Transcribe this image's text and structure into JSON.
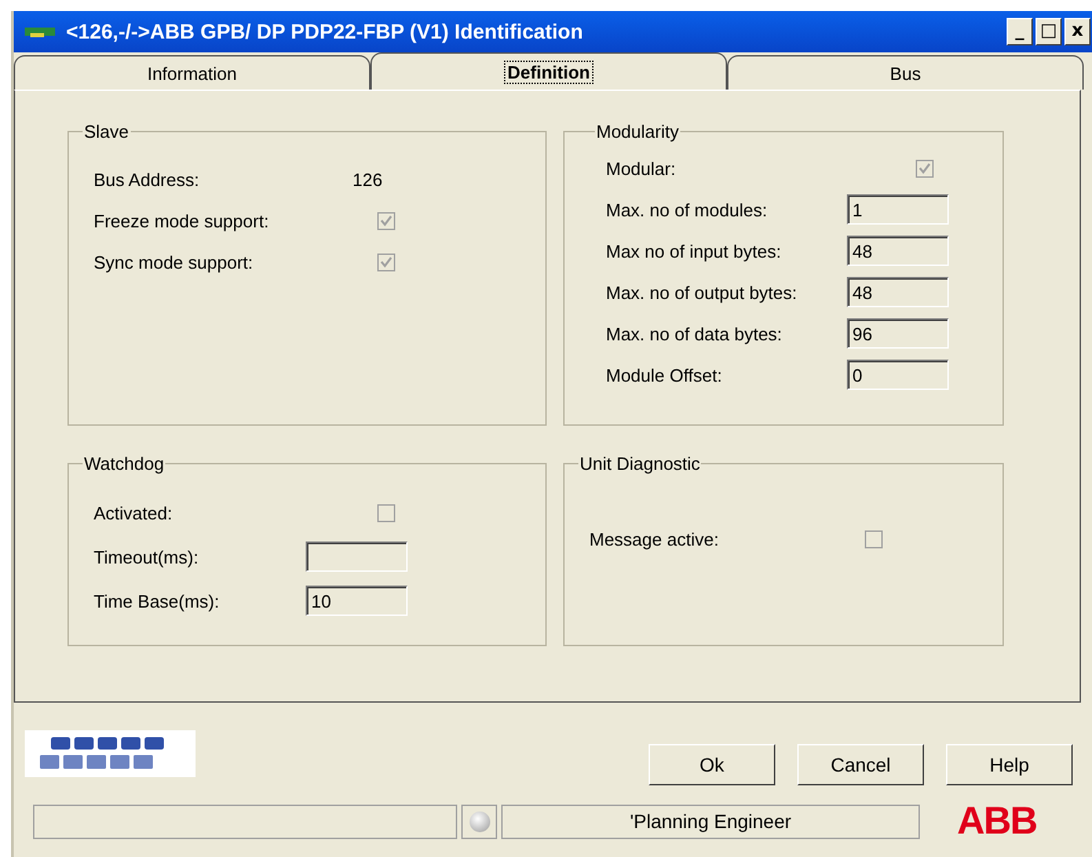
{
  "window": {
    "title": "<126,-/->ABB GPB/ DP PDP22-FBP (V1) Identification",
    "controls": [
      "_",
      "□",
      "x"
    ]
  },
  "tabs": [
    {
      "label": "Information",
      "selected": false
    },
    {
      "label": "Definition",
      "selected": true
    },
    {
      "label": "Bus",
      "selected": false
    }
  ],
  "groups": [
    {
      "title": "Slave",
      "rows": [
        {
          "label": "Bus Address:",
          "kind": "text",
          "value": "126"
        },
        {
          "label": "Freeze mode support:",
          "kind": "checkbox",
          "checked": true
        },
        {
          "label": "Sync mode support:",
          "kind": "checkbox",
          "checked": true
        }
      ]
    },
    {
      "title": "Modularity",
      "rows": [
        {
          "label": "Modular:",
          "kind": "checkbox",
          "checked": true
        },
        {
          "label": "Max. no of modules:",
          "kind": "field",
          "value": "1"
        },
        {
          "label": "Max no of input bytes:",
          "kind": "field",
          "value": "48"
        },
        {
          "label": "Max. no of output bytes:",
          "kind": "field",
          "value": "48"
        },
        {
          "label": "Max. no of data bytes:",
          "kind": "field",
          "value": "96"
        },
        {
          "label": "Module Offset:",
          "kind": "field",
          "value": "0"
        }
      ]
    },
    {
      "title": "Watchdog",
      "rows": [
        {
          "label": "Activated:",
          "kind": "checkbox",
          "checked": false
        },
        {
          "label": "Timeout(ms):",
          "kind": "field"
        },
        {
          "label": "Time Base(ms):",
          "kind": "field",
          "value": "10"
        }
      ]
    },
    {
      "title": "Unit Diagnostic",
      "rows": [
        {
          "label": "Message active:",
          "kind": "checkbox",
          "checked": false
        }
      ]
    }
  ],
  "buttons": [
    "Ok",
    "Cancel",
    "Help"
  ],
  "status_bar": {
    "user": "'Planning Engineer",
    "logo": "ABB"
  }
}
